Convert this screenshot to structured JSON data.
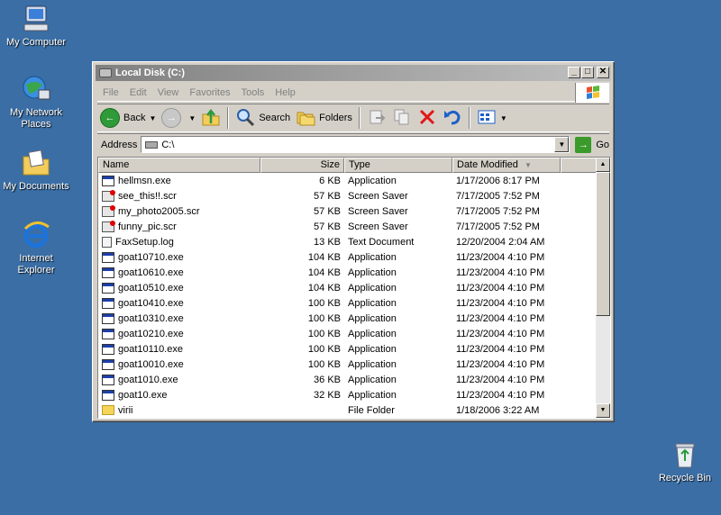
{
  "desktop": {
    "icons": [
      {
        "label": "My Computer",
        "icon": "my-computer-icon"
      },
      {
        "label": "My Network Places",
        "icon": "network-places-icon"
      },
      {
        "label": "My Documents",
        "icon": "my-documents-icon"
      },
      {
        "label": "Internet Explorer",
        "icon": "internet-explorer-icon"
      },
      {
        "label": "Recycle Bin",
        "icon": "recycle-bin-icon"
      }
    ]
  },
  "window": {
    "title": "Local Disk (C:)",
    "controls": {
      "minimize": "_",
      "maximize": "□",
      "close": "✕"
    }
  },
  "menubar": [
    "File",
    "Edit",
    "View",
    "Favorites",
    "Tools",
    "Help"
  ],
  "toolbar": {
    "back_label": "Back",
    "search_label": "Search",
    "folders_label": "Folders"
  },
  "address": {
    "label": "Address",
    "value": "C:\\",
    "go_label": "Go"
  },
  "columns": {
    "name": "Name",
    "size": "Size",
    "type": "Type",
    "date": "Date Modified"
  },
  "files": [
    {
      "name": "hellmsn.exe",
      "size": "6 KB",
      "type": "Application",
      "date": "1/17/2006 8:17 PM",
      "kind": "app"
    },
    {
      "name": "see_this!!.scr",
      "size": "57 KB",
      "type": "Screen Saver",
      "date": "7/17/2005 7:52 PM",
      "kind": "scr"
    },
    {
      "name": "my_photo2005.scr",
      "size": "57 KB",
      "type": "Screen Saver",
      "date": "7/17/2005 7:52 PM",
      "kind": "scr"
    },
    {
      "name": "funny_pic.scr",
      "size": "57 KB",
      "type": "Screen Saver",
      "date": "7/17/2005 7:52 PM",
      "kind": "scr"
    },
    {
      "name": "FaxSetup.log",
      "size": "13 KB",
      "type": "Text Document",
      "date": "12/20/2004 2:04 AM",
      "kind": "log"
    },
    {
      "name": "goat10710.exe",
      "size": "104 KB",
      "type": "Application",
      "date": "11/23/2004 4:10 PM",
      "kind": "app"
    },
    {
      "name": "goat10610.exe",
      "size": "104 KB",
      "type": "Application",
      "date": "11/23/2004 4:10 PM",
      "kind": "app"
    },
    {
      "name": "goat10510.exe",
      "size": "104 KB",
      "type": "Application",
      "date": "11/23/2004 4:10 PM",
      "kind": "app"
    },
    {
      "name": "goat10410.exe",
      "size": "100 KB",
      "type": "Application",
      "date": "11/23/2004 4:10 PM",
      "kind": "app"
    },
    {
      "name": "goat10310.exe",
      "size": "100 KB",
      "type": "Application",
      "date": "11/23/2004 4:10 PM",
      "kind": "app"
    },
    {
      "name": "goat10210.exe",
      "size": "100 KB",
      "type": "Application",
      "date": "11/23/2004 4:10 PM",
      "kind": "app"
    },
    {
      "name": "goat10110.exe",
      "size": "100 KB",
      "type": "Application",
      "date": "11/23/2004 4:10 PM",
      "kind": "app"
    },
    {
      "name": "goat10010.exe",
      "size": "100 KB",
      "type": "Application",
      "date": "11/23/2004 4:10 PM",
      "kind": "app"
    },
    {
      "name": "goat1010.exe",
      "size": "36 KB",
      "type": "Application",
      "date": "11/23/2004 4:10 PM",
      "kind": "app"
    },
    {
      "name": "goat10.exe",
      "size": "32 KB",
      "type": "Application",
      "date": "11/23/2004 4:10 PM",
      "kind": "app"
    },
    {
      "name": "virii",
      "size": "",
      "type": "File Folder",
      "date": "1/18/2006 3:22 AM",
      "kind": "folder"
    }
  ],
  "colors": {
    "desktop": "#3a6ea5",
    "window_face": "#d4d0c8",
    "inactive_title": "#808080"
  }
}
